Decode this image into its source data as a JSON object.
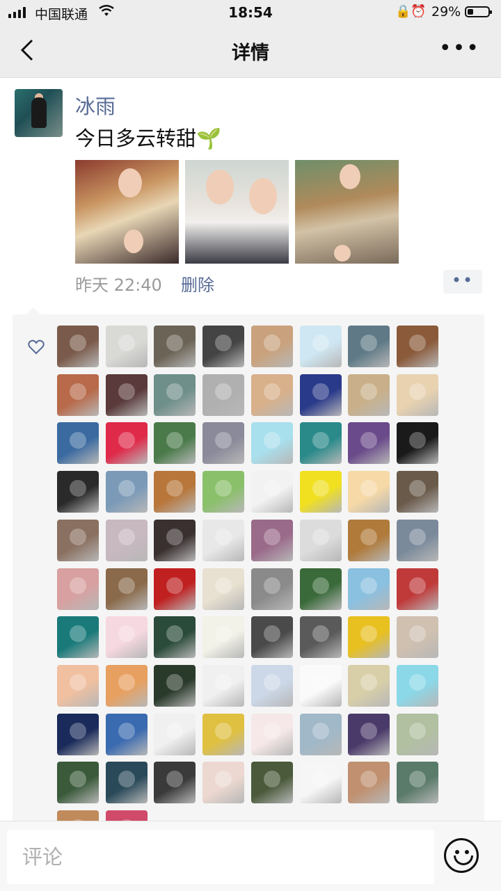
{
  "status_bar": {
    "carrier": "中国联通",
    "time": "18:54",
    "battery_percent": "29%",
    "battery_level": 0.29
  },
  "nav": {
    "title": "详情",
    "back_icon": "chevron-left-icon",
    "more_icon": "more-horizontal-icon"
  },
  "post": {
    "author": "冰雨",
    "text": "今日多云转甜🌱",
    "time": "昨天 22:40",
    "delete_label": "删除",
    "photo_count": 3
  },
  "likes": {
    "icon": "heart-icon",
    "avatar_colors": [
      "#7a5a4a",
      "#d9d9d6",
      "#6b6355",
      "#444444",
      "#c9a27d",
      "#cfe7f2",
      "#5f7a86",
      "#8a5a3a",
      "#b86a4a",
      "#5a3a3a",
      "#6f8f8a",
      "#b0b0b0",
      "#d8b08a",
      "#2a3a8a",
      "#c9b08a",
      "#e8d2b0",
      "#3a6aa0",
      "#e02a4a",
      "#4a7a4a",
      "#8a8a9a",
      "#a9e0ee",
      "#2a8a8a",
      "#6a4a8a",
      "#1a1a1a",
      "#2a2a2a",
      "#7a9ab8",
      "#b8763a",
      "#8ac06a",
      "#f2f2f2",
      "#f0e020",
      "#f6d9a6",
      "#6a5a4a",
      "#8a7060",
      "#c8b8c0",
      "#3a3030",
      "#e8e8e8",
      "#9a6a8a",
      "#dcdcdc",
      "#b07a3a",
      "#7a8a9a",
      "#d8a0a0",
      "#8a6a4a",
      "#c02020",
      "#e8e0d0",
      "#8a8a8a",
      "#3a6a3a",
      "#8ac0e0",
      "#c03a3a",
      "#1a7a7a",
      "#f6d8e0",
      "#2a4a3a",
      "#f2f2e8",
      "#4a4a4a",
      "#5a5a5a",
      "#e8c020",
      "#cfc0b0",
      "#f0c0a0",
      "#e8a060",
      "#2a3a2a",
      "#f0f0f0",
      "#ccd8e8",
      "#fafafa",
      "#d8cfa8",
      "#8ad8e8",
      "#1a2a5a",
      "#3a6ab0",
      "#f0f0f0",
      "#e0c040",
      "#f6e8e8",
      "#a0b8c8",
      "#4a3a6a",
      "#b0c0a0",
      "#3a5a3a",
      "#2a4a5a",
      "#3a3a3a",
      "#ecd8d0",
      "#4a5a3a",
      "#f6f6f6",
      "#c09070",
      "#5a7a6a",
      "#c08a5a",
      "#d04a6a"
    ]
  },
  "comment": {
    "placeholder": "评论",
    "emoji_icon": "smiley-face-icon"
  }
}
